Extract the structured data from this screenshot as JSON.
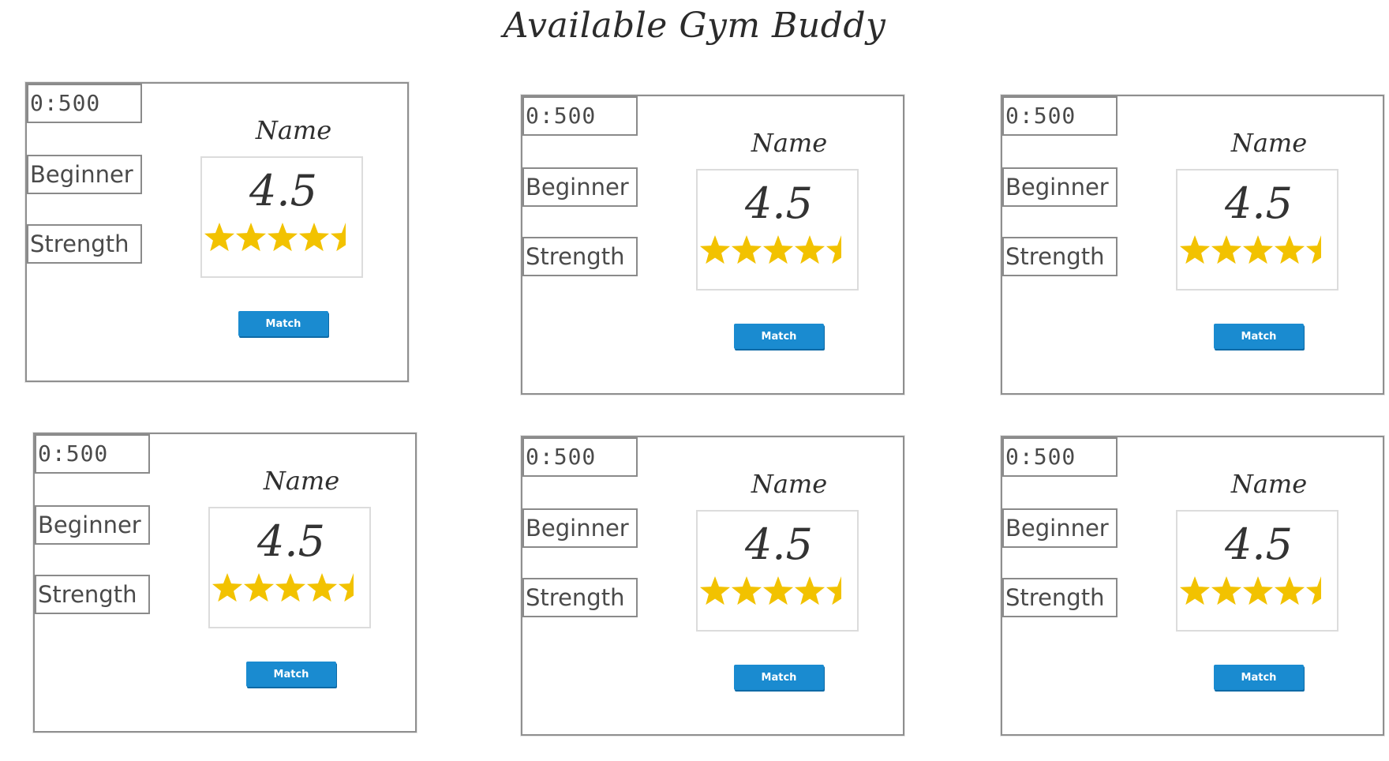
{
  "header": {
    "title": "Available Gym Buddy"
  },
  "colors": {
    "star": "#f2c200",
    "button": "#1a8bd0"
  },
  "cards": [
    {
      "time": "0:500",
      "level": "Beginner",
      "type": "Strength",
      "name": "Name",
      "rating_text": "4.5",
      "rating": 4.5,
      "button_label": "Match"
    },
    {
      "time": "0:500",
      "level": "Beginner",
      "type": "Strength",
      "name": "Name",
      "rating_text": "4.5",
      "rating": 4.5,
      "button_label": "Match"
    },
    {
      "time": "0:500",
      "level": "Beginner",
      "type": "Strength",
      "name": "Name",
      "rating_text": "4.5",
      "rating": 4.5,
      "button_label": "Match"
    },
    {
      "time": "0:500",
      "level": "Beginner",
      "type": "Strength",
      "name": "Name",
      "rating_text": "4.5",
      "rating": 4.5,
      "button_label": "Match"
    },
    {
      "time": "0:500",
      "level": "Beginner",
      "type": "Strength",
      "name": "Name",
      "rating_text": "4.5",
      "rating": 4.5,
      "button_label": "Match"
    },
    {
      "time": "0:500",
      "level": "Beginner",
      "type": "Strength",
      "name": "Name",
      "rating_text": "4.5",
      "rating": 4.5,
      "button_label": "Match"
    }
  ]
}
